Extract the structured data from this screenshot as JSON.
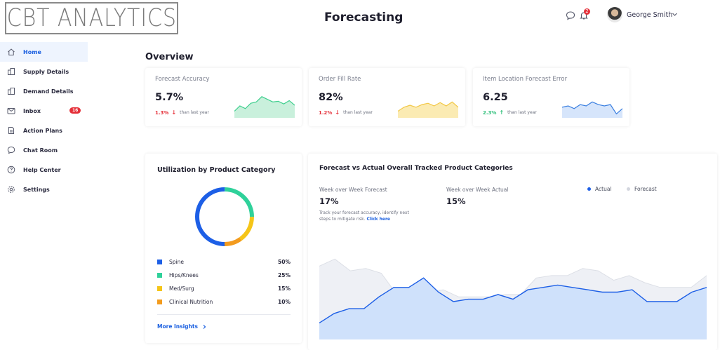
{
  "brand": {
    "logo_text": "CBT ANALYTICS"
  },
  "header": {
    "title": "Forecasting",
    "user_name": "George Smith",
    "notification_count": "2"
  },
  "sidebar": {
    "items": [
      {
        "label": "Home",
        "icon": "home-icon",
        "active": true
      },
      {
        "label": "Supply Details",
        "icon": "building-icon"
      },
      {
        "label": "Demand Details",
        "icon": "building-icon"
      },
      {
        "label": "Inbox",
        "icon": "mail-icon",
        "badge": "16"
      },
      {
        "label": "Action Plans",
        "icon": "document-icon"
      },
      {
        "label": "Chat Room",
        "icon": "chat-icon"
      },
      {
        "label": "Help Center",
        "icon": "help-icon"
      },
      {
        "label": "Settings",
        "icon": "gear-icon"
      }
    ]
  },
  "overview": {
    "title": "Overview",
    "cards": [
      {
        "title": "Forecast Accuracy",
        "value": "5.7%",
        "delta": "1.3%",
        "direction": "down",
        "delta_color": "#e5313a",
        "caption": "than last year",
        "spark_color": "#3fcf8e",
        "spark_fill": "#c9f0dc",
        "spark": [
          30,
          38,
          34,
          42,
          44,
          52,
          48,
          44,
          45,
          41,
          46,
          39
        ]
      },
      {
        "title": "Order Fill Rate",
        "value": "82%",
        "delta": "1.2%",
        "direction": "down",
        "delta_color": "#e5313a",
        "caption": "than last year",
        "spark_color": "#f2c744",
        "spark_fill": "#fbebb3",
        "spark": [
          30,
          36,
          39,
          36,
          40,
          42,
          38,
          43,
          38,
          44,
          36
        ]
      },
      {
        "title": "Item Location Forecast Error",
        "value": "6.25",
        "direction": "up",
        "delta": "2.3%",
        "delta_color": "#2ebf7a",
        "caption": "than last year",
        "spark_color": "#3a7fe0",
        "spark_fill": "#d6e5fb",
        "spark": [
          36,
          38,
          34,
          40,
          38,
          44,
          40,
          38,
          40,
          26,
          34
        ]
      }
    ]
  },
  "utilization": {
    "title": "Utilization by Product Category",
    "categories": [
      {
        "name": "Spine",
        "pct": "50%",
        "value": 50,
        "color": "#1d5fe6"
      },
      {
        "name": "Hips/Knees",
        "pct": "25%",
        "value": 25,
        "color": "#2fd19a"
      },
      {
        "name": "Med/Surg",
        "pct": "15%",
        "value": 15,
        "color": "#f5c518"
      },
      {
        "name": "Clinical Nutrition",
        "pct": "10%",
        "value": 10,
        "color": "#f39b1e"
      }
    ],
    "more_label": "More Insights"
  },
  "forecast": {
    "title": "Forecast vs Actual Overall Tracked Product Categories",
    "wow_forecast_label": "Week over Week Forecast",
    "wow_forecast_value": "17%",
    "wow_actual_label": "Week over Week Actual",
    "wow_actual_value": "15%",
    "note": "Track your forecast accuracy, identify next steps to mitigate risk.",
    "note_link": "Click here",
    "legend": [
      {
        "name": "Actual",
        "color": "#1d5fe6"
      },
      {
        "name": "Forecast",
        "color": "#d3d6de"
      }
    ],
    "chart_data": {
      "type": "area",
      "series": [
        {
          "name": "Forecast",
          "values": [
            62,
            68,
            58,
            60,
            56,
            38,
            44,
            40,
            42,
            36,
            36,
            36,
            38,
            38,
            52,
            54,
            54,
            60,
            58,
            50,
            54,
            48,
            44,
            44,
            44,
            54
          ]
        },
        {
          "name": "Actual",
          "values": [
            14,
            22,
            26,
            26,
            36,
            44,
            44,
            52,
            40,
            32,
            34,
            34,
            38,
            34,
            42,
            44,
            46,
            44,
            42,
            40,
            40,
            42,
            32,
            32,
            32,
            40,
            44
          ]
        }
      ]
    }
  }
}
